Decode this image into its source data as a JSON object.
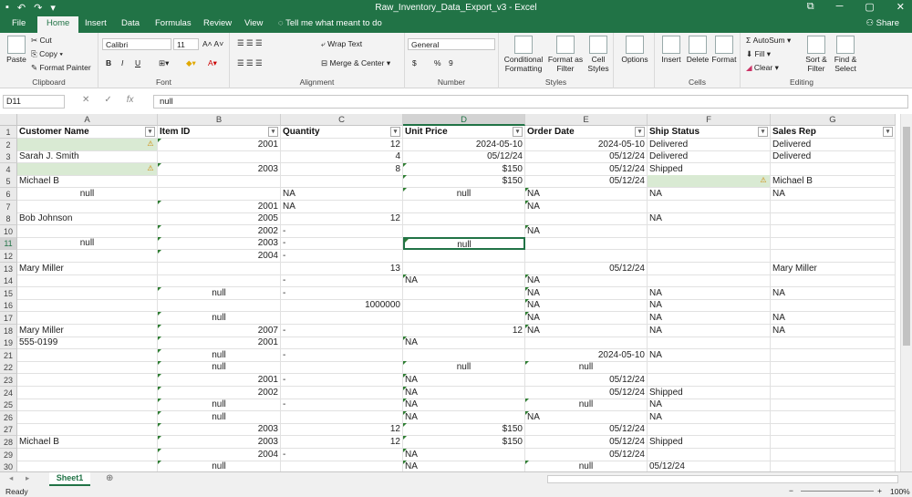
{
  "window": {
    "title": "Raw_Inventory_Data_Export_v3  -  Excel",
    "min": "─",
    "restore": "▢",
    "close": "✕",
    "ribbon_display": "⧉"
  },
  "qat": {
    "save": "▪",
    "undo": "↶",
    "redo": "↷",
    "more": "▾"
  },
  "tabs": [
    "File",
    "Home",
    "Insert",
    "Data",
    "Formulas",
    "Review",
    "View"
  ],
  "tell_me": "Tell me what meant to do",
  "share": "Share",
  "ribbon": {
    "clipboard": {
      "label": "Clipboard",
      "paste": "Paste",
      "cut": "Cut",
      "copy": "Copy",
      "format_painter": "Format Painter"
    },
    "font": {
      "label": "Font",
      "name": "Calibri",
      "size": "11",
      "bold": "B",
      "italic": "I",
      "underline": "U"
    },
    "alignment": {
      "label": "Alignment",
      "wrap": "Wrap Text",
      "merge": "Merge & Center"
    },
    "number": {
      "label": "Number",
      "format": "General",
      "currency": "$",
      "percent": "%",
      "comma": "9"
    },
    "styles": {
      "label": "Styles",
      "conditional": "Conditional Formatting",
      "format_table": "Format as Filter",
      "cell_styles": "Cell Styles"
    },
    "options": {
      "label": "Options"
    },
    "cells": {
      "label": "Cells",
      "insert": "Insert",
      "delete": "Delete",
      "format": "Format"
    },
    "editing": {
      "label": "Editing",
      "autosum": "AutoSum",
      "fill": "Fill",
      "clear": "Clear",
      "sort": "Sort & Filter",
      "find": "Find & Select"
    }
  },
  "formula_bar": {
    "name_box": "D11",
    "cancel": "✕",
    "enter": "✓",
    "fx": "fx",
    "value": "null"
  },
  "columns": [
    "A",
    "B",
    "C",
    "D",
    "E",
    "F",
    "G"
  ],
  "headers": [
    "Customer Name",
    "Item ID",
    "Quantity",
    "Unit Price",
    "Order Date",
    "Ship Status",
    "Sales Rep"
  ],
  "rows": [
    {
      "n": "2",
      "c": [
        "",
        "2001",
        "12",
        "2024-05-10",
        "2024-05-10",
        "Delivered",
        "Delivered"
      ]
    },
    {
      "n": "3",
      "c": [
        "Sarah J. Smith",
        "",
        "4",
        "05/12/24",
        "05/12/24",
        "Delivered",
        "Delivered"
      ]
    },
    {
      "n": "4",
      "c": [
        "",
        "2003",
        "8",
        "$150",
        "05/12/24",
        "Shipped",
        ""
      ]
    },
    {
      "n": "5",
      "c": [
        "Michael B",
        "",
        "",
        "$150",
        "05/12/24",
        "",
        "Michael B"
      ]
    },
    {
      "n": "6",
      "c": [
        "null",
        "",
        "NA",
        "null",
        "NA",
        "NA",
        "NA"
      ]
    },
    {
      "n": "7",
      "c": [
        "",
        "2001",
        "NA",
        "",
        "NA",
        "",
        ""
      ]
    },
    {
      "n": "8",
      "c": [
        "Bob Johnson",
        "2005",
        "12",
        "",
        "",
        "NA",
        ""
      ]
    },
    {
      "n": "10",
      "c": [
        "",
        "2002",
        "-",
        "",
        "NA",
        "",
        ""
      ]
    },
    {
      "n": "11",
      "c": [
        "null",
        "2003",
        "-",
        "null",
        "",
        "",
        ""
      ]
    },
    {
      "n": "12",
      "c": [
        "",
        "2004",
        "-",
        "",
        "",
        "",
        ""
      ]
    },
    {
      "n": "13",
      "c": [
        "Mary Miller",
        "",
        "13",
        "",
        "05/12/24",
        "",
        "Mary Miller"
      ]
    },
    {
      "n": "14",
      "c": [
        "",
        "",
        "-",
        "NA",
        "NA",
        "",
        ""
      ]
    },
    {
      "n": "15",
      "c": [
        "",
        "null",
        "-",
        "",
        "NA",
        "NA",
        "NA"
      ]
    },
    {
      "n": "16",
      "c": [
        "",
        "",
        "1000000",
        "",
        "NA",
        "NA",
        ""
      ]
    },
    {
      "n": "17",
      "c": [
        "",
        "null",
        "",
        "",
        "NA",
        "NA",
        "NA"
      ]
    },
    {
      "n": "18",
      "c": [
        "Mary Miller",
        "2007",
        "-",
        "12",
        "NA",
        "NA",
        "NA"
      ]
    },
    {
      "n": "19",
      "c": [
        "555-0199",
        "2001",
        "",
        "NA",
        "",
        "",
        ""
      ]
    },
    {
      "n": "21",
      "c": [
        "",
        "null",
        "-",
        "",
        "2024-05-10",
        "NA",
        ""
      ]
    },
    {
      "n": "22",
      "c": [
        "",
        "null",
        "",
        "null",
        "null",
        "",
        ""
      ]
    },
    {
      "n": "23",
      "c": [
        "",
        "2001",
        "-",
        "NA",
        "05/12/24",
        "",
        ""
      ]
    },
    {
      "n": "24",
      "c": [
        "",
        "2002",
        "",
        "NA",
        "05/12/24",
        "Shipped",
        ""
      ]
    },
    {
      "n": "25",
      "c": [
        "",
        "null",
        "-",
        "NA",
        "null",
        "NA",
        ""
      ]
    },
    {
      "n": "26",
      "c": [
        "",
        "null",
        "",
        "NA",
        "NA",
        "NA",
        ""
      ]
    },
    {
      "n": "27",
      "c": [
        "",
        "2003",
        "12",
        "$150",
        "05/12/24",
        "",
        ""
      ]
    },
    {
      "n": "28",
      "c": [
        "Michael B",
        "2003",
        "12",
        "$150",
        "05/12/24",
        "Shipped",
        ""
      ]
    },
    {
      "n": "29",
      "c": [
        "",
        "2004",
        "-",
        "NA",
        "05/12/24",
        "",
        ""
      ]
    },
    {
      "n": "30",
      "c": [
        "",
        "null",
        "",
        "NA",
        "null",
        "05/12/24",
        ""
      ]
    }
  ],
  "row1": "1",
  "sheet": {
    "name": "Sheet1",
    "add": "⊕",
    "prev": "◂",
    "next": "▸"
  },
  "status": {
    "ready": "Ready",
    "zoom": "100%",
    "minus": "−",
    "plus": "+"
  }
}
